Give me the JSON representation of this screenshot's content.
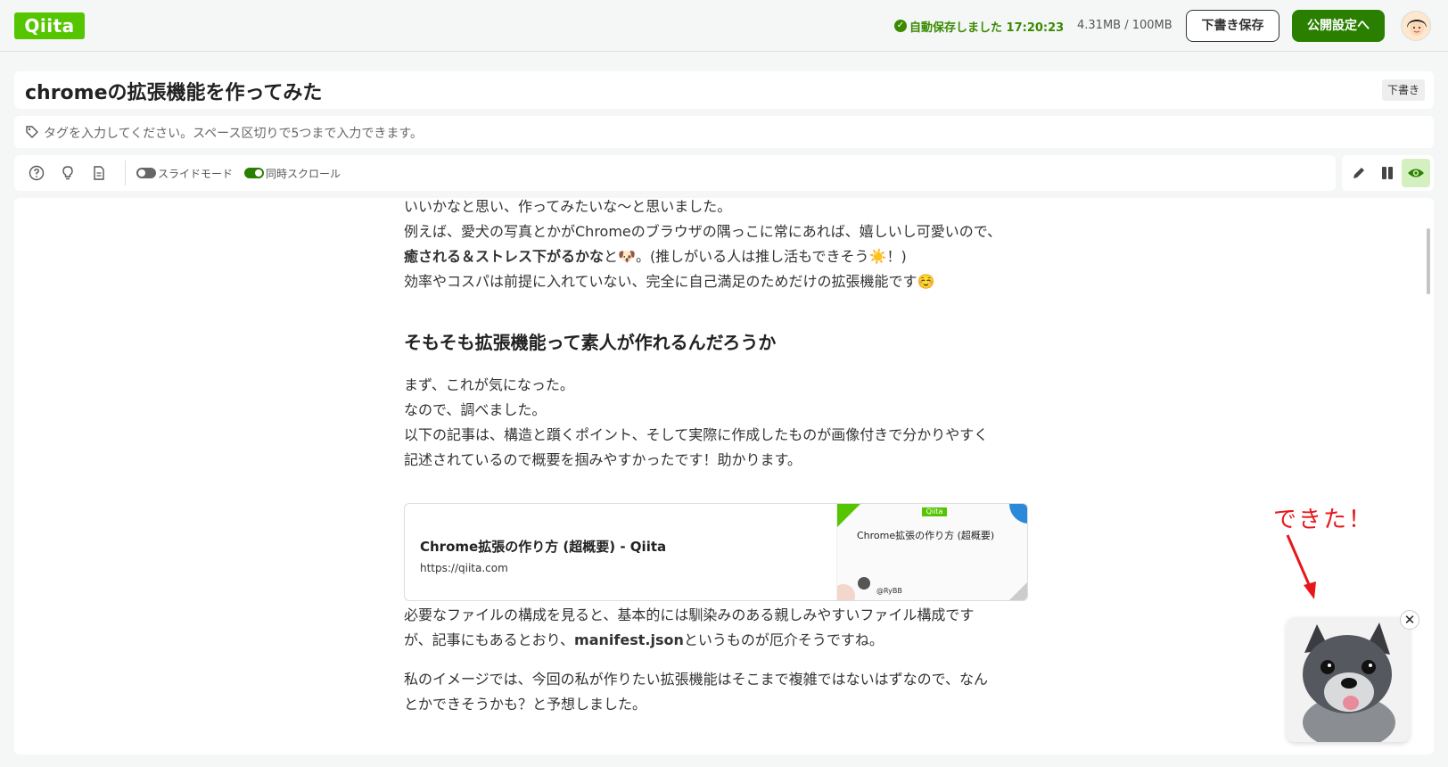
{
  "header": {
    "logo": "Qiita",
    "autosave": "自動保存しました 17:20:23",
    "storage": "4.31MB / 100MB",
    "draft_button": "下書き保存",
    "publish_button": "公開設定へ"
  },
  "editor": {
    "title": "chromeの拡張機能を作ってみた",
    "status_badge": "下書き",
    "tag_placeholder": "タグを入力してください。スペース区切りで5つまで入力できます。"
  },
  "toolbar": {
    "slide_mode_label": "スライドモード",
    "sync_scroll_label": "同時スクロール",
    "slide_mode_on": false,
    "sync_scroll_on": true
  },
  "article": {
    "p1_line1": "いいかなと思い、作ってみたいな〜と思いました。",
    "p1_line2": "例えば、愛犬の写真とかがChromeのブラウザの隅っこに常にあれば、嬉しいし可愛いので、",
    "p1_line3_bold": "癒される＆ストレス下がるかな",
    "p1_line3_rest": "と🐶。(推しがいる人は推し活もできそう☀️！)",
    "p1_line4": "効率やコスパは前提に入れていない、完全に自己満足のためだけの拡張機能です☺️",
    "h2": "そもそも拡張機能って素人が作れるんだろうか",
    "p2_line1": "まず、これが気になった。",
    "p2_line2": "なので、調べました。",
    "p2_line3": "以下の記事は、構造と躓くポイント、そして実際に作成したものが画像付きで分かりやすく",
    "p2_line4": "記述されているので概要を掴みやすかったです！助かります。",
    "p3_line1": "必要なファイルの構成を見ると、基本的には馴染みのある親しみやすいファイル構成です",
    "p3_line2_pre": "が、記事にもあるとおり、",
    "p3_line2_bold": "manifest.json",
    "p3_line2_post": "というものが厄介そうですね。",
    "p4_line1": "私のイメージでは、今回の私が作りたい拡張機能はそこまで複雑ではないはずなので、なん",
    "p4_line2": "とかできそうかも？と予想しました。"
  },
  "link_card": {
    "title": "Chrome拡張の作り方 (超概要) - Qiita",
    "url": "https://qiita.com",
    "thumb_logo": "Qiita",
    "thumb_title": "Chrome拡張の作り方 (超概要)",
    "thumb_author": "@RyBB"
  },
  "annotation": {
    "text": "できた！"
  },
  "colors": {
    "brand": "#55c500",
    "publish": "#2a7f00",
    "annotation": "#e8161a"
  }
}
